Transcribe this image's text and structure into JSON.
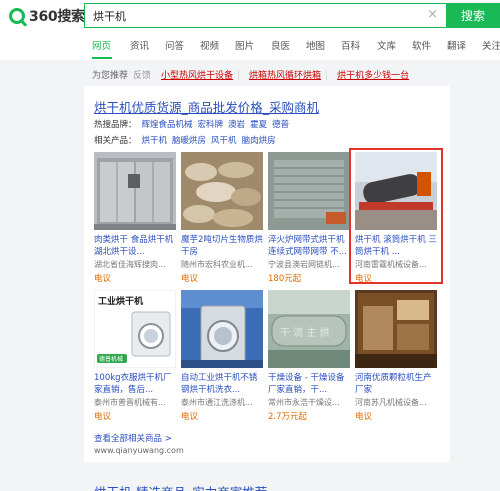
{
  "header": {
    "logo_text": "360搜索",
    "search_value": "烘干机",
    "clear_glyph": "×",
    "search_button": "搜索"
  },
  "tabs": [
    "网页",
    "资讯",
    "问答",
    "视频",
    "图片",
    "良医",
    "地图",
    "百科",
    "文库",
    "软件",
    "翻译",
    "关注"
  ],
  "recommend": {
    "label": "为您推荐",
    "feedback": "反馈",
    "links": [
      "小型热风烘干设备",
      "烘箱热风循环烘箱",
      "烘干机多少钱一台"
    ]
  },
  "ad": {
    "title": "烘干机优质货源_商品批发价格_采购商机",
    "hot_brands_label": "热搜品牌：",
    "hot_brands": [
      "辉煌食品机械",
      "宏科牌",
      "澳岩",
      "霍夏",
      "德普"
    ],
    "related_label": "相关产品：",
    "related": [
      "烘干机",
      "脑暖烘房",
      "风干机",
      "脑肉烘房"
    ],
    "products": [
      {
        "name": "肉类烘干 食品烘干机 湖北烘干设...",
        "seller": "湖北省佳海辉搜肉...",
        "price": "电议"
      },
      {
        "name": "魔芋2吨切片生物质烘干房",
        "seller": "随州市宏科农业机...",
        "price": "电议"
      },
      {
        "name": "淬火炉网带式烘干机连续式网带网带 不...",
        "seller": "宁波县澳岩网链机...",
        "price": "180元起"
      },
      {
        "name": "烘干机 滚筒烘干机 三筒烘干机 ...",
        "seller": "河南雷霆机械设备...",
        "price": "电议"
      },
      {
        "name": "100kg衣服烘干机厂家直销，售后...",
        "seller": "泰州市普晋机械有...",
        "price": "电议"
      },
      {
        "name": "自动工业烘干机不锈钢烘干机洗衣...",
        "seller": "泰州市通江洗涤机...",
        "price": "电议"
      },
      {
        "name": "干燥设备 - 干燥设备厂家直销，干...",
        "seller": "常州市永浩干燥设...",
        "price": "2.7万元起"
      },
      {
        "name": "河南优质颗粒机生产厂家",
        "seller": "河南苏凡机械设备...",
        "price": "电议"
      }
    ],
    "image_captions": [
      "工业烘干机",
      "德普机械",
      "干 流 主 烘"
    ],
    "more_link": "查看全部相关商品 >",
    "site": "www.qianyuwang.com"
  },
  "next_result_title": "烘干机-精选商品_实力商家推荐",
  "colors": {
    "brand_green": "#19b955",
    "link_blue": "#2a4fbf",
    "highlight_red": "#e6332a",
    "price_orange": "#e06a00"
  }
}
